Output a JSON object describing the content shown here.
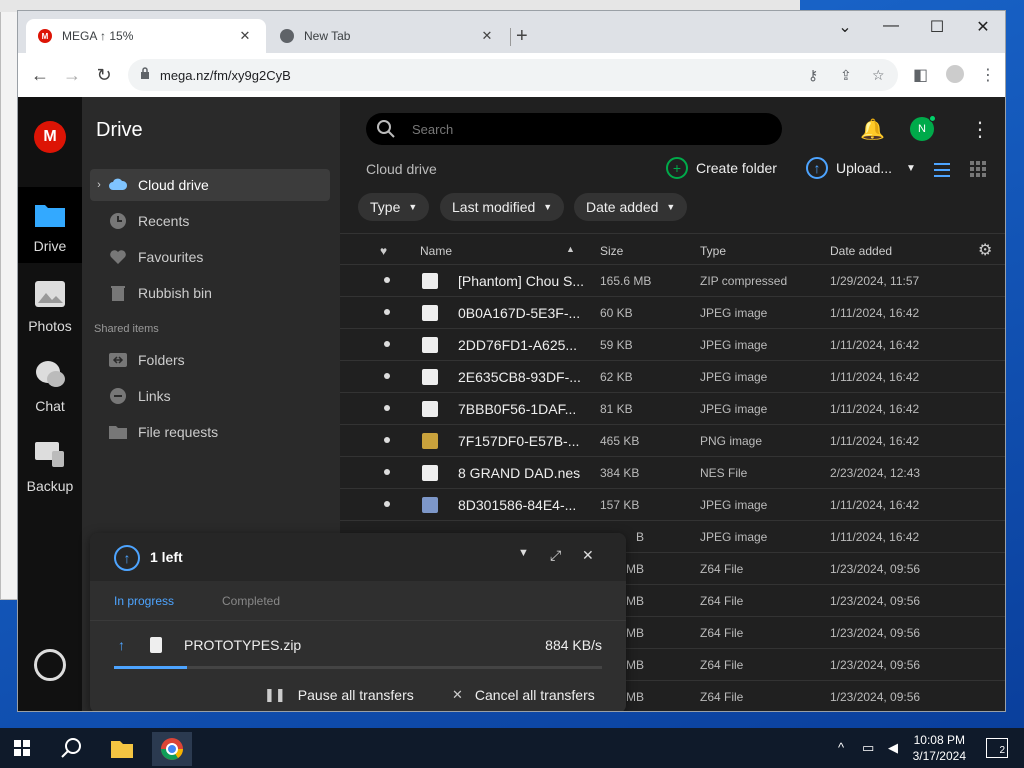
{
  "browser": {
    "tabs": [
      {
        "title": "MEGA ↑ 15%",
        "active": true
      },
      {
        "title": "New Tab",
        "active": false
      }
    ],
    "url": "mega.nz/fm/xy9g2CyB"
  },
  "mega": {
    "logo": "M",
    "rail": [
      {
        "label": "Drive",
        "icon": "folder-icon",
        "active": true
      },
      {
        "label": "Photos",
        "icon": "photos-icon",
        "active": false
      },
      {
        "label": "Chat",
        "icon": "chat-icon",
        "active": false
      },
      {
        "label": "Backup",
        "icon": "backup-icon",
        "active": false
      }
    ],
    "sidebar": {
      "title": "Drive",
      "items": [
        {
          "label": "Cloud drive",
          "icon": "cloud-icon"
        },
        {
          "label": "Recents",
          "icon": "clock-icon"
        },
        {
          "label": "Favourites",
          "icon": "heart-icon"
        },
        {
          "label": "Rubbish bin",
          "icon": "trash-icon"
        }
      ],
      "shared_header": "Shared items",
      "shared": [
        {
          "label": "Folders",
          "icon": "shared-folder-icon"
        },
        {
          "label": "Links",
          "icon": "link-icon"
        },
        {
          "label": "File requests",
          "icon": "file-request-icon"
        }
      ]
    },
    "search_placeholder": "Search",
    "avatar_initial": "N",
    "breadcrumb": "Cloud drive",
    "actions": {
      "create_folder": "Create folder",
      "upload": "Upload..."
    },
    "filters": [
      "Type",
      "Last modified",
      "Date added"
    ],
    "columns": {
      "name": "Name",
      "size": "Size",
      "type": "Type",
      "date": "Date added"
    },
    "files": [
      {
        "name": "[Phantom] Chou S...",
        "size": "165.6 MB",
        "type": "ZIP compressed",
        "date": "1/29/2024, 11:57"
      },
      {
        "name": "0B0A167D-5E3F-...",
        "size": "60 KB",
        "type": "JPEG image",
        "date": "1/11/2024, 16:42"
      },
      {
        "name": "2DD76FD1-A625...",
        "size": "59 KB",
        "type": "JPEG image",
        "date": "1/11/2024, 16:42"
      },
      {
        "name": "2E635CB8-93DF-...",
        "size": "62 KB",
        "type": "JPEG image",
        "date": "1/11/2024, 16:42"
      },
      {
        "name": "7BBB0F56-1DAF...",
        "size": "81 KB",
        "type": "JPEG image",
        "date": "1/11/2024, 16:42"
      },
      {
        "name": "7F157DF0-E57B-...",
        "size": "465 KB",
        "type": "PNG image",
        "date": "1/11/2024, 16:42"
      },
      {
        "name": "8 GRAND DAD.nes",
        "size": "384 KB",
        "type": "NES File",
        "date": "2/23/2024, 12:43"
      },
      {
        "name": "8D301586-84E4-...",
        "size": "157 KB",
        "type": "JPEG image",
        "date": "1/11/2024, 16:42"
      },
      {
        "name": "",
        "size": "B",
        "type": "JPEG image",
        "date": "1/11/2024, 16:42"
      },
      {
        "name": "",
        "size": "MB",
        "type": "Z64 File",
        "date": "1/23/2024, 09:56"
      },
      {
        "name": "",
        "size": "MB",
        "type": "Z64 File",
        "date": "1/23/2024, 09:56"
      },
      {
        "name": "",
        "size": "MB",
        "type": "Z64 File",
        "date": "1/23/2024, 09:56"
      },
      {
        "name": "",
        "size": "MB",
        "type": "Z64 File",
        "date": "1/23/2024, 09:56"
      },
      {
        "name": "",
        "size": "MB",
        "type": "Z64 File",
        "date": "1/23/2024, 09:56"
      }
    ],
    "transfer": {
      "count_label": "1 left",
      "tabs": {
        "in_progress": "In progress",
        "completed": "Completed"
      },
      "item": {
        "name": "PROTOTYPES.zip",
        "speed": "884 KB/s",
        "progress": 0.15
      },
      "pause_label": "Pause all transfers",
      "cancel_label": "Cancel all transfers"
    }
  },
  "taskbar": {
    "time": "10:08 PM",
    "date": "3/17/2024",
    "notifications": "2"
  },
  "colors": {
    "mega_red": "#dd1405",
    "accent_blue": "#4da4ff",
    "create_green": "#00aa4a"
  }
}
